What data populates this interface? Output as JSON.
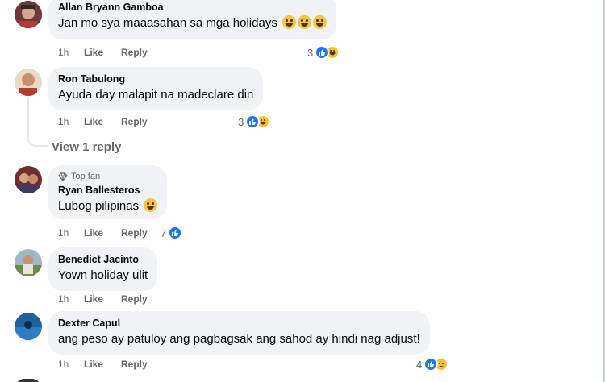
{
  "comments": [
    {
      "author": "Allan Bryann Gamboa",
      "text": "Jan mo sya maaasahan sa mga holidays",
      "time": "1h",
      "like": "Like",
      "reply": "Reply",
      "reaction_count": "3",
      "reactions": [
        "like",
        "haha"
      ],
      "avatar_color": "#a0524b"
    },
    {
      "author": "Ron Tabulong",
      "text": "Ayuda day malapit na madeclare din",
      "time": "1h",
      "like": "Like",
      "reply": "Reply",
      "reaction_count": "3",
      "reactions": [
        "like",
        "haha"
      ],
      "avatar_color": "#c9a27a"
    },
    {
      "badge": "Top fan",
      "author": "Ryan Ballesteros",
      "text": "Lubog pilipinas",
      "time": "1h",
      "like": "Like",
      "reply": "Reply",
      "reaction_count": "7",
      "reactions": [
        "like"
      ],
      "avatar_color": "#8a3a3a"
    },
    {
      "author": "Benedict Jacinto",
      "text": "Yown holiday ulit",
      "time": "1h",
      "like": "Like",
      "reply": "Reply",
      "avatar_color": "#6f8a9a"
    },
    {
      "author": "Dexter Capul",
      "text": "ang peso ay patuloy ang pagbagsak ang sahod ay hindi nag adjust!",
      "time": "1h",
      "like": "Like",
      "reply": "Reply",
      "reaction_count": "4",
      "reactions": [
        "like",
        "sad"
      ],
      "avatar_color": "#1f5f9e"
    }
  ],
  "view_replies": "View 1 reply",
  "colors": {
    "bubble": "#f0f2f5",
    "meta": "#65676b",
    "like_blue": "#1877f2"
  }
}
